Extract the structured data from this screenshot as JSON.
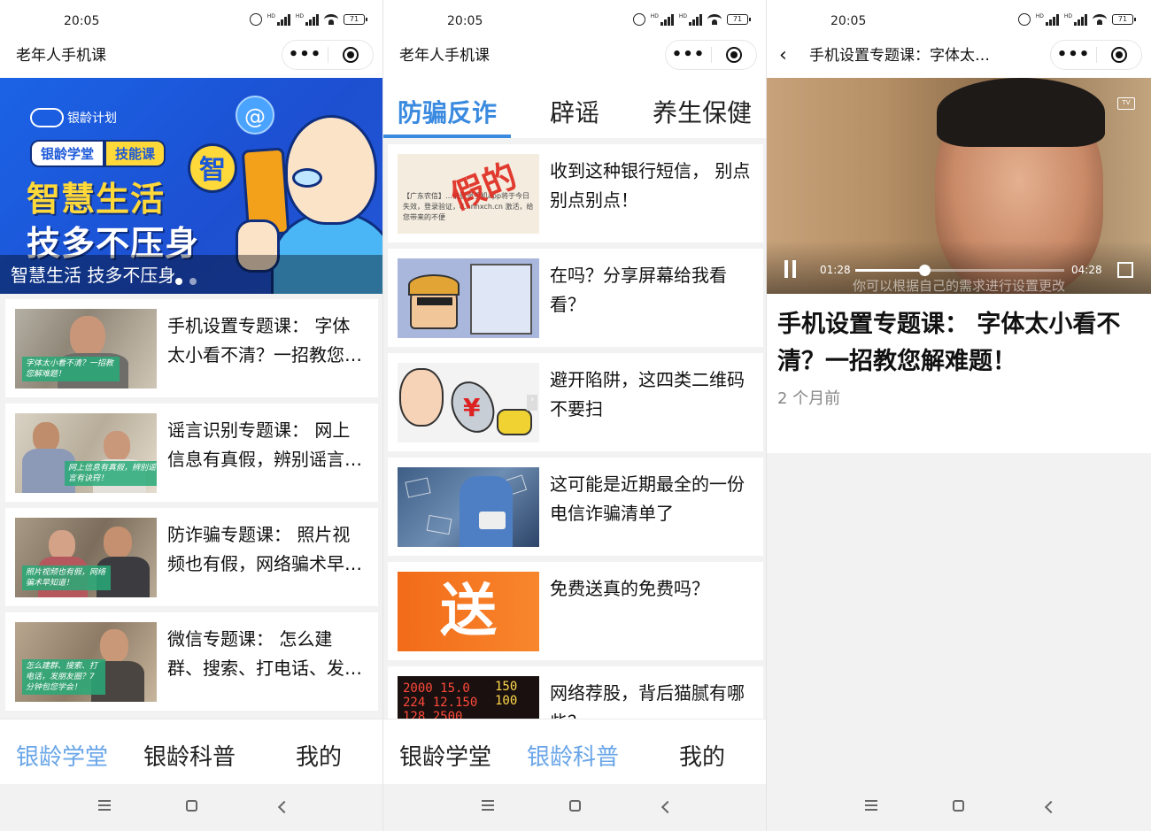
{
  "status_time": "20:05",
  "battery": "71",
  "panel1": {
    "title": "老年人手机课",
    "banner": {
      "logo_text": "银龄计划",
      "tag1": "银龄学堂",
      "tag2": "技能课",
      "line1": "智慧生活",
      "line2": "技多不压身",
      "badge": "智",
      "at_symbol": "@",
      "caption": "智慧生活 技多不压身"
    },
    "cards": [
      {
        "title": "手机设置专题课： 字体太小看不清？一招教您解难题！",
        "thumb_overlay": "字体太小看不清？一招教您解难题！"
      },
      {
        "title": "谣言识别专题课： 网上信息有真假，辨别谣言有诀窍！",
        "thumb_overlay": "网上信息有真假，辨别谣言有诀窍！"
      },
      {
        "title": "防诈骗专题课： 照片视频也有假，网络骗术早知道！",
        "thumb_overlay": "照片视频也有假，网络骗术早知道！"
      },
      {
        "title": "微信专题课： 怎么建群、搜索、打电话、发朋友圈？",
        "thumb_overlay": "怎么建群、搜索、打电话，发朋友圈？7分钟包您学会！"
      }
    ],
    "bottom_tabs": [
      "银龄学堂",
      "银龄科普",
      "我的"
    ],
    "active_tab": 0
  },
  "panel2": {
    "title": "老年人手机课",
    "category_tabs": [
      "防骗反诈",
      "辟谣",
      "养生保健"
    ],
    "active_category": 0,
    "articles": [
      {
        "title": "收到这种银行短信， 别点别点别点！",
        "thumb_stamp": "假的",
        "thumb_text": "【广东农信】…请登录手机app将于今日失效，登录验证，d.hnnxch.cn 激活，给您带来的不便"
      },
      {
        "title": "在吗？分享屏幕给我看看？"
      },
      {
        "title": "避开陷阱，这四类二维码不要扫"
      },
      {
        "title": "这可能是近期最全的一份电信诈骗清单了"
      },
      {
        "title": "免费送真的免费吗？",
        "thumb_char": "送"
      },
      {
        "title": "网络荐股，背后猫腻有哪些？"
      }
    ],
    "bottom_tabs": [
      "银龄学堂",
      "银龄科普",
      "我的"
    ],
    "active_tab": 1
  },
  "panel3": {
    "title": "手机设置专题课：字体太…",
    "video": {
      "current_time": "01:28",
      "duration": "04:28",
      "progress_fraction": 0.33,
      "subtitle": "你可以根据自己的需求进行设置更改",
      "tv_label": "TV"
    },
    "video_title": "手机设置专题课： 字体太小看不清？一招教您解难题！",
    "published": "2 个月前"
  },
  "icons": {
    "more": "more-dots-icon",
    "close": "target-close-icon",
    "back": "chevron-left-icon"
  }
}
